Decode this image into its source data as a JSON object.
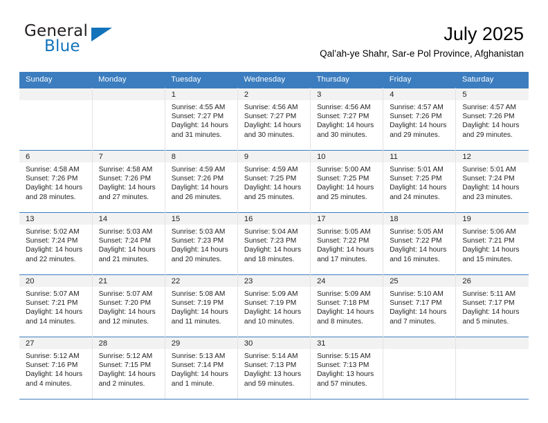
{
  "brand": {
    "name_part1": "General",
    "name_part2": "Blue",
    "logo_icon": "triangle-flag-icon",
    "accent_color": "#1273ba"
  },
  "header": {
    "title": "July 2025",
    "subtitle": "Qal’ah-ye Shahr, Sar-e Pol Province, Afghanistan"
  },
  "colors": {
    "header_row_bg": "#3b7dbf",
    "daynum_bg": "#f2f2f2",
    "grid_line": "#e2e2e2",
    "week_separator": "#3b7dbf"
  },
  "weekdays": [
    "Sunday",
    "Monday",
    "Tuesday",
    "Wednesday",
    "Thursday",
    "Friday",
    "Saturday"
  ],
  "labels": {
    "sunrise_prefix": "Sunrise:",
    "sunset_prefix": "Sunset:",
    "daylight_prefix": "Daylight:"
  },
  "weeks": [
    [
      {
        "day": "",
        "sunrise": "",
        "sunset": "",
        "daylight_line1": "",
        "daylight_line2": ""
      },
      {
        "day": "",
        "sunrise": "",
        "sunset": "",
        "daylight_line1": "",
        "daylight_line2": ""
      },
      {
        "day": "1",
        "sunrise": "Sunrise: 4:55 AM",
        "sunset": "Sunset: 7:27 PM",
        "daylight_line1": "Daylight: 14 hours",
        "daylight_line2": "and 31 minutes."
      },
      {
        "day": "2",
        "sunrise": "Sunrise: 4:56 AM",
        "sunset": "Sunset: 7:27 PM",
        "daylight_line1": "Daylight: 14 hours",
        "daylight_line2": "and 30 minutes."
      },
      {
        "day": "3",
        "sunrise": "Sunrise: 4:56 AM",
        "sunset": "Sunset: 7:27 PM",
        "daylight_line1": "Daylight: 14 hours",
        "daylight_line2": "and 30 minutes."
      },
      {
        "day": "4",
        "sunrise": "Sunrise: 4:57 AM",
        "sunset": "Sunset: 7:26 PM",
        "daylight_line1": "Daylight: 14 hours",
        "daylight_line2": "and 29 minutes."
      },
      {
        "day": "5",
        "sunrise": "Sunrise: 4:57 AM",
        "sunset": "Sunset: 7:26 PM",
        "daylight_line1": "Daylight: 14 hours",
        "daylight_line2": "and 29 minutes."
      }
    ],
    [
      {
        "day": "6",
        "sunrise": "Sunrise: 4:58 AM",
        "sunset": "Sunset: 7:26 PM",
        "daylight_line1": "Daylight: 14 hours",
        "daylight_line2": "and 28 minutes."
      },
      {
        "day": "7",
        "sunrise": "Sunrise: 4:58 AM",
        "sunset": "Sunset: 7:26 PM",
        "daylight_line1": "Daylight: 14 hours",
        "daylight_line2": "and 27 minutes."
      },
      {
        "day": "8",
        "sunrise": "Sunrise: 4:59 AM",
        "sunset": "Sunset: 7:26 PM",
        "daylight_line1": "Daylight: 14 hours",
        "daylight_line2": "and 26 minutes."
      },
      {
        "day": "9",
        "sunrise": "Sunrise: 4:59 AM",
        "sunset": "Sunset: 7:25 PM",
        "daylight_line1": "Daylight: 14 hours",
        "daylight_line2": "and 25 minutes."
      },
      {
        "day": "10",
        "sunrise": "Sunrise: 5:00 AM",
        "sunset": "Sunset: 7:25 PM",
        "daylight_line1": "Daylight: 14 hours",
        "daylight_line2": "and 25 minutes."
      },
      {
        "day": "11",
        "sunrise": "Sunrise: 5:01 AM",
        "sunset": "Sunset: 7:25 PM",
        "daylight_line1": "Daylight: 14 hours",
        "daylight_line2": "and 24 minutes."
      },
      {
        "day": "12",
        "sunrise": "Sunrise: 5:01 AM",
        "sunset": "Sunset: 7:24 PM",
        "daylight_line1": "Daylight: 14 hours",
        "daylight_line2": "and 23 minutes."
      }
    ],
    [
      {
        "day": "13",
        "sunrise": "Sunrise: 5:02 AM",
        "sunset": "Sunset: 7:24 PM",
        "daylight_line1": "Daylight: 14 hours",
        "daylight_line2": "and 22 minutes."
      },
      {
        "day": "14",
        "sunrise": "Sunrise: 5:03 AM",
        "sunset": "Sunset: 7:24 PM",
        "daylight_line1": "Daylight: 14 hours",
        "daylight_line2": "and 21 minutes."
      },
      {
        "day": "15",
        "sunrise": "Sunrise: 5:03 AM",
        "sunset": "Sunset: 7:23 PM",
        "daylight_line1": "Daylight: 14 hours",
        "daylight_line2": "and 20 minutes."
      },
      {
        "day": "16",
        "sunrise": "Sunrise: 5:04 AM",
        "sunset": "Sunset: 7:23 PM",
        "daylight_line1": "Daylight: 14 hours",
        "daylight_line2": "and 18 minutes."
      },
      {
        "day": "17",
        "sunrise": "Sunrise: 5:05 AM",
        "sunset": "Sunset: 7:22 PM",
        "daylight_line1": "Daylight: 14 hours",
        "daylight_line2": "and 17 minutes."
      },
      {
        "day": "18",
        "sunrise": "Sunrise: 5:05 AM",
        "sunset": "Sunset: 7:22 PM",
        "daylight_line1": "Daylight: 14 hours",
        "daylight_line2": "and 16 minutes."
      },
      {
        "day": "19",
        "sunrise": "Sunrise: 5:06 AM",
        "sunset": "Sunset: 7:21 PM",
        "daylight_line1": "Daylight: 14 hours",
        "daylight_line2": "and 15 minutes."
      }
    ],
    [
      {
        "day": "20",
        "sunrise": "Sunrise: 5:07 AM",
        "sunset": "Sunset: 7:21 PM",
        "daylight_line1": "Daylight: 14 hours",
        "daylight_line2": "and 14 minutes."
      },
      {
        "day": "21",
        "sunrise": "Sunrise: 5:07 AM",
        "sunset": "Sunset: 7:20 PM",
        "daylight_line1": "Daylight: 14 hours",
        "daylight_line2": "and 12 minutes."
      },
      {
        "day": "22",
        "sunrise": "Sunrise: 5:08 AM",
        "sunset": "Sunset: 7:19 PM",
        "daylight_line1": "Daylight: 14 hours",
        "daylight_line2": "and 11 minutes."
      },
      {
        "day": "23",
        "sunrise": "Sunrise: 5:09 AM",
        "sunset": "Sunset: 7:19 PM",
        "daylight_line1": "Daylight: 14 hours",
        "daylight_line2": "and 10 minutes."
      },
      {
        "day": "24",
        "sunrise": "Sunrise: 5:09 AM",
        "sunset": "Sunset: 7:18 PM",
        "daylight_line1": "Daylight: 14 hours",
        "daylight_line2": "and 8 minutes."
      },
      {
        "day": "25",
        "sunrise": "Sunrise: 5:10 AM",
        "sunset": "Sunset: 7:17 PM",
        "daylight_line1": "Daylight: 14 hours",
        "daylight_line2": "and 7 minutes."
      },
      {
        "day": "26",
        "sunrise": "Sunrise: 5:11 AM",
        "sunset": "Sunset: 7:17 PM",
        "daylight_line1": "Daylight: 14 hours",
        "daylight_line2": "and 5 minutes."
      }
    ],
    [
      {
        "day": "27",
        "sunrise": "Sunrise: 5:12 AM",
        "sunset": "Sunset: 7:16 PM",
        "daylight_line1": "Daylight: 14 hours",
        "daylight_line2": "and 4 minutes."
      },
      {
        "day": "28",
        "sunrise": "Sunrise: 5:12 AM",
        "sunset": "Sunset: 7:15 PM",
        "daylight_line1": "Daylight: 14 hours",
        "daylight_line2": "and 2 minutes."
      },
      {
        "day": "29",
        "sunrise": "Sunrise: 5:13 AM",
        "sunset": "Sunset: 7:14 PM",
        "daylight_line1": "Daylight: 14 hours",
        "daylight_line2": "and 1 minute."
      },
      {
        "day": "30",
        "sunrise": "Sunrise: 5:14 AM",
        "sunset": "Sunset: 7:13 PM",
        "daylight_line1": "Daylight: 13 hours",
        "daylight_line2": "and 59 minutes."
      },
      {
        "day": "31",
        "sunrise": "Sunrise: 5:15 AM",
        "sunset": "Sunset: 7:13 PM",
        "daylight_line1": "Daylight: 13 hours",
        "daylight_line2": "and 57 minutes."
      },
      {
        "day": "",
        "sunrise": "",
        "sunset": "",
        "daylight_line1": "",
        "daylight_line2": ""
      },
      {
        "day": "",
        "sunrise": "",
        "sunset": "",
        "daylight_line1": "",
        "daylight_line2": ""
      }
    ]
  ]
}
